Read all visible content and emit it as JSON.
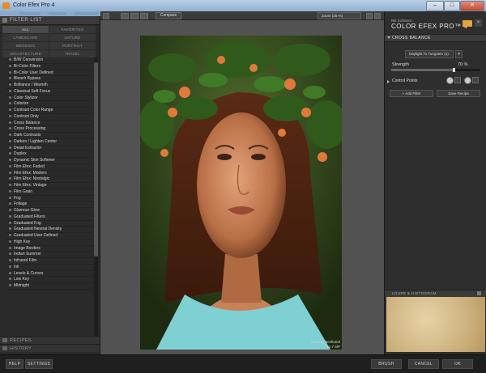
{
  "window": {
    "title": "Color Efex Pro 4",
    "controls": [
      "–",
      "□",
      "✕"
    ]
  },
  "filter_list": {
    "header": "FILTER LIST",
    "categories": [
      "ALL",
      "FAVORITES",
      "LANDSCAPE",
      "NATURE",
      "WEDDING",
      "PORTRAIT",
      "ARCHITECTURE",
      "TRAVEL"
    ],
    "active_category": "ALL",
    "filters": [
      "B/W Conversion",
      "Bi-Color Filters",
      "Bi-Color User Defined",
      "Bleach Bypass",
      "Brilliance / Warmth",
      "Classical Soft Focus",
      "Color Stylizer",
      "Colorize",
      "Contrast Color Range",
      "Contrast Only",
      "Cross Balance",
      "Cross Processing",
      "Dark Contrasts",
      "Darken / Lighten Center",
      "Detail Extractor",
      "Duplex",
      "Dynamic Skin Softener",
      "Film Efex: Faded",
      "Film Efex: Modern",
      "Film Efex: Nostalgic",
      "Film Efex: Vintage",
      "Film Grain",
      "Fog",
      "Foliage",
      "Glamour Glow",
      "Graduated Filters",
      "Graduated Fog",
      "Graduated Neutral Density",
      "Graduated User Defined",
      "High Key",
      "Image Borders",
      "Indian Summer",
      "Infrared Film",
      "Ink",
      "Levels & Curves",
      "Low Key",
      "Midnight"
    ],
    "recipes_label": "RECIPES",
    "history_label": "HISTORY"
  },
  "toolbar": {
    "compare_label": "Compare",
    "zoom_label": "Zoom (25 %)"
  },
  "canvas": {
    "caption_line1": "Darjaan Neelkand",
    "caption_line2": "12.7 MP"
  },
  "right_panel": {
    "brand_small": "Nik Software",
    "brand_title": "COLOR EFEX PRO™ 4",
    "filter_header": "CROSS BALANCE",
    "preset_value": "Daylight To Tungsten (1)",
    "strength_label": "Strength",
    "strength_value": "70 %",
    "strength_fraction": 0.7,
    "control_points_label": "Control Points",
    "add_filter_label": "+ Add Filter",
    "save_recipe_label": "Save Recipe",
    "loupe_label": "LOUPE & HISTOGRAM"
  },
  "bottom_bar": {
    "help_label": "HELP",
    "settings_label": "SETTINGS",
    "brush_label": "BRUSH",
    "cancel_label": "CANCEL",
    "ok_label": "OK"
  }
}
